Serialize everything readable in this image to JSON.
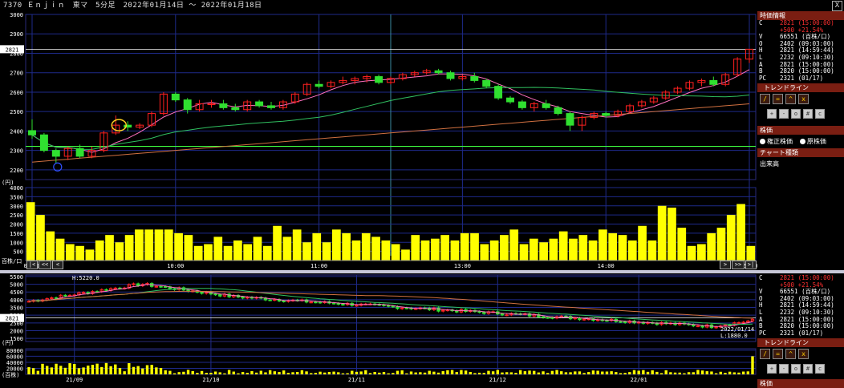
{
  "title": "7370 Ｅｎｊｉｎ　東マ　5分足　2022年01月14日 ～ 2022年01月18日",
  "close_label": "X",
  "info_panel": {
    "header": "時価情報",
    "rows": [
      {
        "k": "C",
        "v": "2821 (15:00:00)",
        "color": "#ff3030"
      },
      {
        "k": "",
        "v": "+500 +21.54%",
        "color": "#ff3030"
      },
      {
        "k": "V",
        "v": "66551 (百株/口)"
      },
      {
        "k": "O",
        "v": "2402 (09:03:00)"
      },
      {
        "k": "H",
        "v": "2821 (14:59:44)"
      },
      {
        "k": "L",
        "v": "2232 (09:10:30)"
      },
      {
        "k": "A",
        "v": "2821 (15:00:00)"
      },
      {
        "k": "B",
        "v": "2820 (15:00:00)"
      },
      {
        "k": "PC",
        "v": "2321 (01/17)"
      }
    ],
    "trendline_header": "トレンドライン",
    "kabuka_header": "株価",
    "radio1": "権正株価",
    "radio2": "原株価",
    "chart_type_header": "チャート種類",
    "chart_type_value": "出来高",
    "bottom_header": "株価"
  },
  "nav": {
    "first": "|<",
    "prev2": "<<",
    "prev": "<",
    "next": ">",
    "next2": ">>",
    "last": ">|"
  },
  "chart_data": [
    {
      "type": "candlestick",
      "y_ticks": [
        "3000",
        "2900",
        "2800",
        "2700",
        "2600",
        "2500",
        "2400",
        "2300",
        "2200"
      ],
      "ylim": [
        2150,
        3000
      ],
      "unit_label": "(円)",
      "price_marker": "2821",
      "x_ticks": [
        "09:00",
        "10:00",
        "11:00",
        "13:00",
        "14:00",
        "15:00"
      ],
      "x_tick_pos": [
        0,
        12,
        24,
        36,
        48,
        60
      ],
      "horizontal_line": 2321,
      "up_color": "#ff2020",
      "down_color": "#30e030",
      "candles": [
        [
          2402,
          2460,
          2360,
          2380
        ],
        [
          2380,
          2390,
          2290,
          2300
        ],
        [
          2300,
          2310,
          2232,
          2270
        ],
        [
          2270,
          2320,
          2250,
          2310
        ],
        [
          2310,
          2330,
          2260,
          2270
        ],
        [
          2270,
          2320,
          2260,
          2300
        ],
        [
          2300,
          2400,
          2290,
          2390
        ],
        [
          2390,
          2480,
          2380,
          2430
        ],
        [
          2430,
          2450,
          2400,
          2420
        ],
        [
          2420,
          2440,
          2410,
          2430
        ],
        [
          2430,
          2500,
          2420,
          2490
        ],
        [
          2490,
          2600,
          2480,
          2590
        ],
        [
          2590,
          2600,
          2550,
          2560
        ],
        [
          2560,
          2570,
          2490,
          2510
        ],
        [
          2510,
          2560,
          2500,
          2540
        ],
        [
          2540,
          2560,
          2520,
          2540
        ],
        [
          2540,
          2560,
          2510,
          2520
        ],
        [
          2520,
          2540,
          2500,
          2510
        ],
        [
          2510,
          2560,
          2500,
          2550
        ],
        [
          2550,
          2560,
          2520,
          2530
        ],
        [
          2530,
          2550,
          2510,
          2520
        ],
        [
          2520,
          2560,
          2510,
          2550
        ],
        [
          2550,
          2600,
          2540,
          2590
        ],
        [
          2590,
          2650,
          2580,
          2640
        ],
        [
          2640,
          2660,
          2620,
          2630
        ],
        [
          2630,
          2660,
          2620,
          2650
        ],
        [
          2650,
          2680,
          2640,
          2660
        ],
        [
          2660,
          2680,
          2640,
          2670
        ],
        [
          2670,
          2690,
          2650,
          2680
        ],
        [
          2680,
          2690,
          2640,
          2650
        ],
        [
          2650,
          2680,
          2640,
          2670
        ],
        [
          2670,
          2700,
          2660,
          2690
        ],
        [
          2690,
          2710,
          2680,
          2700
        ],
        [
          2700,
          2720,
          2690,
          2710
        ],
        [
          2710,
          2720,
          2690,
          2700
        ],
        [
          2700,
          2710,
          2660,
          2670
        ],
        [
          2670,
          2690,
          2660,
          2680
        ],
        [
          2680,
          2700,
          2650,
          2660
        ],
        [
          2660,
          2670,
          2620,
          2630
        ],
        [
          2630,
          2640,
          2560,
          2570
        ],
        [
          2570,
          2580,
          2540,
          2550
        ],
        [
          2550,
          2560,
          2510,
          2520
        ],
        [
          2520,
          2550,
          2500,
          2540
        ],
        [
          2540,
          2560,
          2510,
          2520
        ],
        [
          2520,
          2530,
          2480,
          2490
        ],
        [
          2490,
          2500,
          2400,
          2430
        ],
        [
          2430,
          2480,
          2400,
          2470
        ],
        [
          2470,
          2500,
          2460,
          2490
        ],
        [
          2490,
          2500,
          2470,
          2480
        ],
        [
          2480,
          2510,
          2470,
          2500
        ],
        [
          2500,
          2540,
          2490,
          2530
        ],
        [
          2530,
          2560,
          2520,
          2550
        ],
        [
          2550,
          2580,
          2540,
          2570
        ],
        [
          2570,
          2610,
          2560,
          2600
        ],
        [
          2600,
          2630,
          2590,
          2620
        ],
        [
          2620,
          2660,
          2610,
          2650
        ],
        [
          2650,
          2670,
          2630,
          2660
        ],
        [
          2660,
          2680,
          2630,
          2640
        ],
        [
          2640,
          2700,
          2630,
          2690
        ],
        [
          2690,
          2780,
          2680,
          2770
        ],
        [
          2770,
          2821,
          2750,
          2821
        ]
      ]
    },
    {
      "type": "bar",
      "y_ticks": [
        "4000",
        "3500",
        "3000",
        "2500",
        "2000",
        "1500",
        "1000",
        "500"
      ],
      "ylim": [
        0,
        4000
      ],
      "unit_label": "百株/口",
      "color": "#ffff00",
      "values": [
        3200,
        2500,
        1600,
        1200,
        900,
        800,
        600,
        1100,
        1400,
        1000,
        1400,
        1700,
        1700,
        1700,
        1700,
        1500,
        1400,
        800,
        900,
        1300,
        800,
        1100,
        900,
        1300,
        800,
        1900,
        1300,
        1700,
        1000,
        1500,
        1000,
        1700,
        1500,
        1100,
        1500,
        1300,
        1100,
        900,
        600,
        1400,
        1100,
        1200,
        1400,
        1100,
        1500,
        1500,
        900,
        1100,
        1400,
        1700,
        900,
        1200,
        1000,
        1200,
        1600,
        1200,
        1400,
        1100,
        1700,
        1500,
        1400,
        1100,
        1900,
        1100,
        3000,
        2900,
        1800,
        800,
        900,
        1500,
        1800,
        2500,
        3100,
        800
      ]
    },
    {
      "type": "candlestick",
      "y_ticks": [
        "5500",
        "5000",
        "4500",
        "4000",
        "3500",
        "3000",
        "2500",
        "2000",
        "1500"
      ],
      "ylim": [
        1300,
        5600
      ],
      "unit_label": "(円)",
      "price_marker": "2821",
      "high_label": "H:5220.0",
      "low_label": "L:1880.0",
      "low_date": "2022/01/14",
      "x_ticks": [
        "21/09",
        "21/10",
        "21/11",
        "21/12",
        "22/01"
      ],
      "x_tick_pos": [
        10,
        40,
        72,
        103,
        134
      ]
    },
    {
      "type": "bar",
      "y_ticks": [
        "80000",
        "60000",
        "40000",
        "20000"
      ],
      "ylim": [
        0,
        85000
      ],
      "unit_label": "(百株)",
      "color": "#ffff00"
    }
  ]
}
